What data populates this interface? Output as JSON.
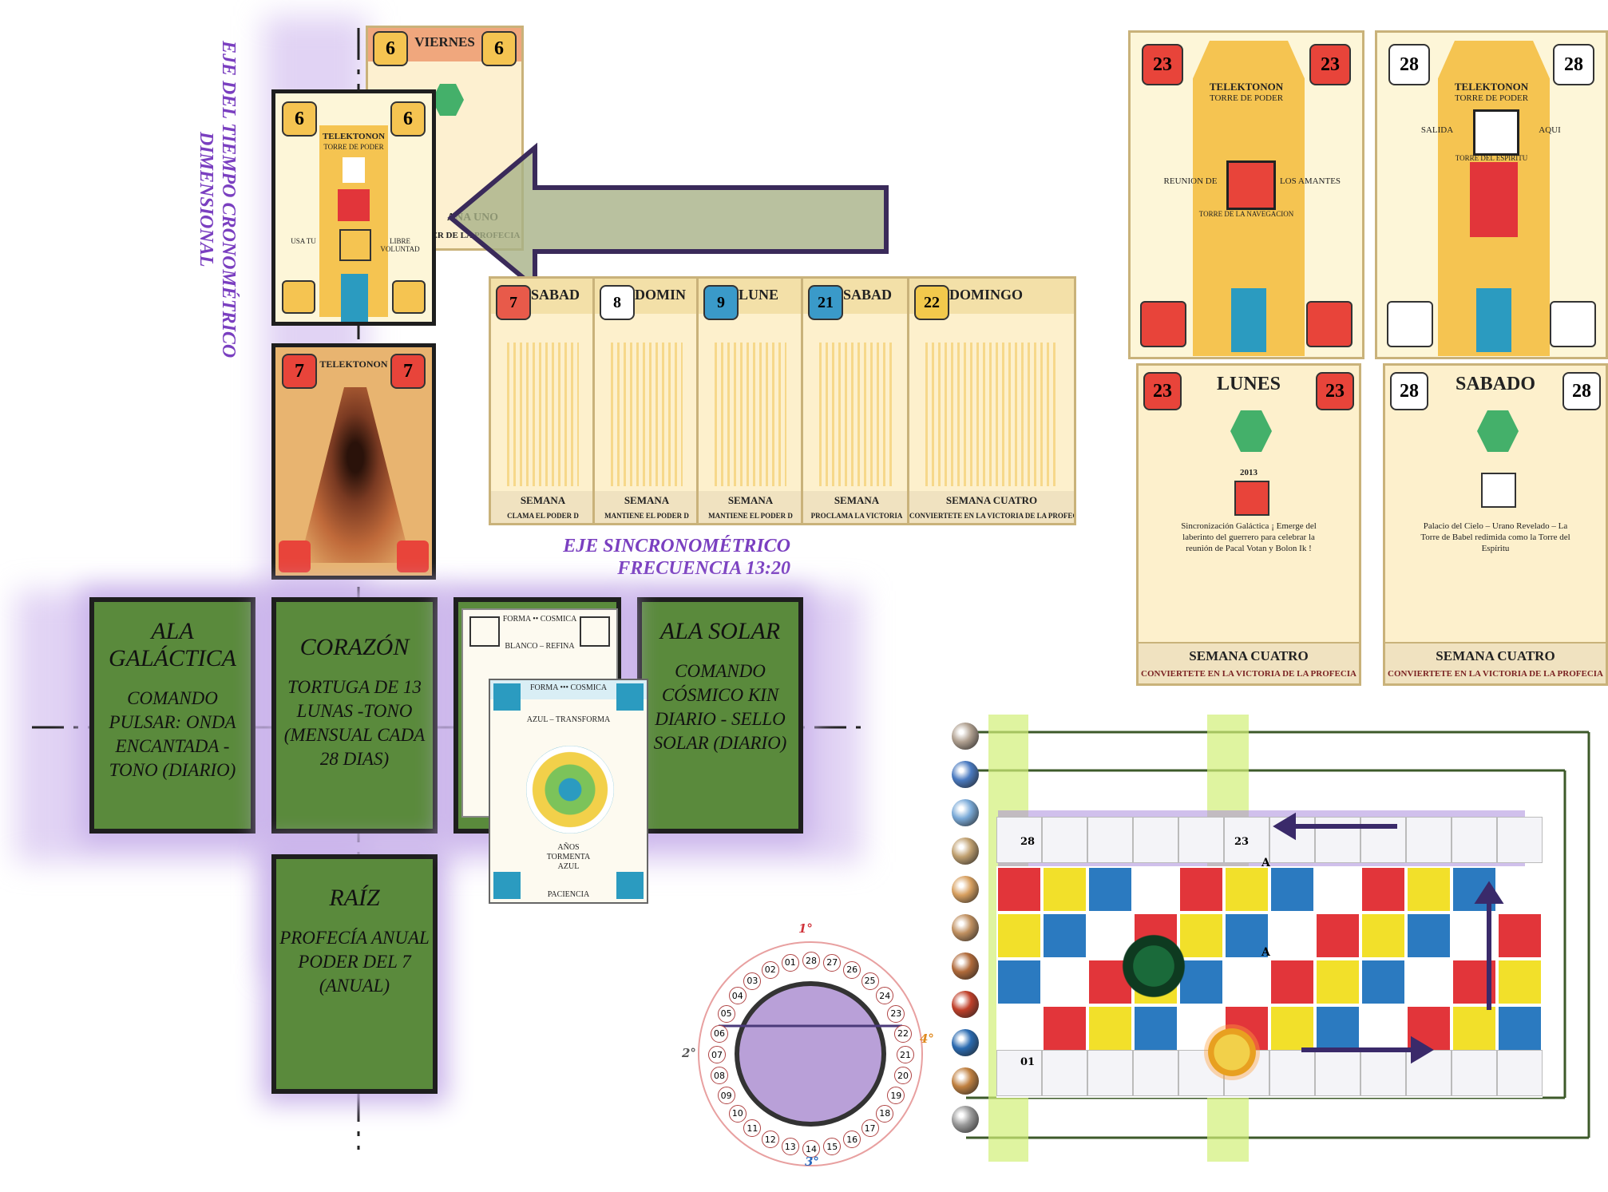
{
  "axes": {
    "vertical_title": "EJE DEL TIEMPO CRONOMÉTRICO DIMENSIONAL",
    "horizontal_title_1": "EJE SINCRONOMÉTRICO",
    "horizontal_title_2": "FRECUENCIA 13:20"
  },
  "cross": {
    "ala_galactica": {
      "title": "ALA GALÁCTICA",
      "body": "COMANDO PULSAR: ONDA ENCANTADA -TONO (DIARIO)"
    },
    "corazon": {
      "title": "CORAZÓN",
      "body": "TORTUGA DE 13 LUNAS -TONO (MENSUAL CADA 28 DIAS)"
    },
    "ala_solar": {
      "title": "ALA SOLAR",
      "body": "COMANDO CÓSMICO KIN DIARIO - SELLO SOLAR (DIARIO)"
    },
    "raiz": {
      "title": "RAÍZ",
      "body": "PROFECÍA ANUAL PODER DEL 7 (ANUAL)"
    }
  },
  "cards_top": {
    "viernes": {
      "day": "VIERNES",
      "num": "6",
      "footer": "ANA UNO",
      "sub": "DER DE LA PROFECIA"
    },
    "telek6": {
      "num": "6",
      "title": "TELEKTONON",
      "sub": "TORRE DE PODER",
      "left": "USA TU",
      "right": "LIBRE VOLUNTAD"
    },
    "telek7": {
      "num": "7",
      "title": "TELEKTONON"
    }
  },
  "day_cards": [
    {
      "num": "7",
      "day": "SABAD",
      "footer": "SEMANA",
      "sub": "CLAMA EL PODER D",
      "color": "#e85a4a"
    },
    {
      "num": "8",
      "day": "DOMIN",
      "footer": "SEMANA",
      "sub": "MANTIENE EL PODER D",
      "color": "#ffffff"
    },
    {
      "num": "9",
      "day": "LUNE",
      "footer": "SEMANA",
      "sub": "MANTIENE EL PODER D",
      "color": "#3a9ac9"
    },
    {
      "num": "21",
      "day": "SABAD",
      "footer": "SEMANA",
      "sub": "PROCLAMA LA VICTORIA",
      "color": "#3a9ac9"
    },
    {
      "num": "22",
      "day": "DOMINGO",
      "footer": "SEMANA CUATRO",
      "sub": "CONVIERTETE EN LA VICTORIA DE LA PROFECIA",
      "color": "#f2c94c"
    }
  ],
  "right_cards": {
    "t23": {
      "num": "23",
      "title": "TELEKTONON",
      "sub": "TORRE DE PODER",
      "left": "REUNION DE",
      "right": "LOS AMANTES",
      "bottom": "TORRE DE LA NAVEGACION"
    },
    "t28": {
      "num": "28",
      "title": "TELEKTONON",
      "sub": "TORRE DE PODER",
      "left": "SALIDA",
      "right": "AQUI",
      "bottom": "TORRE DEL ESPIRITU"
    },
    "lunes": {
      "num": "23",
      "day": "LUNES",
      "footer": "SEMANA CUATRO",
      "sub": "CONVIERTETE EN LA VICTORIA DE LA PROFECIA",
      "year": "2013",
      "body": "Sincronización Galáctica ¡ Emerge del laberinto del guerrero para celebrar la reunión de Pacal Votan y Bolon Ik !"
    },
    "sabado": {
      "num": "28",
      "day": "SABADO",
      "footer": "SEMANA CUATRO",
      "sub": "CONVIERTETE EN LA VICTORIA DE LA PROFECIA",
      "body": "Palacio del Cielo – Urano Revelado – La Torre de Babel redimida como la Torre del Espíritu"
    }
  },
  "oracle_cards": {
    "back": {
      "top": "FORMA •• COSMICA",
      "mid": "BLANCO – REFINA"
    },
    "front": {
      "top": "FORMA ••• COSMICA",
      "mid": "AZUL – TRANSFORMA",
      "bottom1": "AÑOS",
      "bottom2": "TORMENTA",
      "bottom3": "AZUL",
      "footer": "PACIENCIA"
    }
  },
  "turtle_ring": {
    "labels": [
      "1°",
      "2°",
      "3°",
      "4°"
    ],
    "numbers": [
      "01",
      "02",
      "03",
      "04",
      "05",
      "06",
      "07",
      "08",
      "09",
      "10",
      "11",
      "12",
      "13",
      "14",
      "15",
      "16",
      "17",
      "18",
      "19",
      "20",
      "21",
      "22",
      "23",
      "24",
      "25",
      "26",
      "27",
      "28"
    ]
  },
  "board": {
    "labels": [
      "28",
      "23",
      "01",
      "A",
      "A"
    ]
  }
}
